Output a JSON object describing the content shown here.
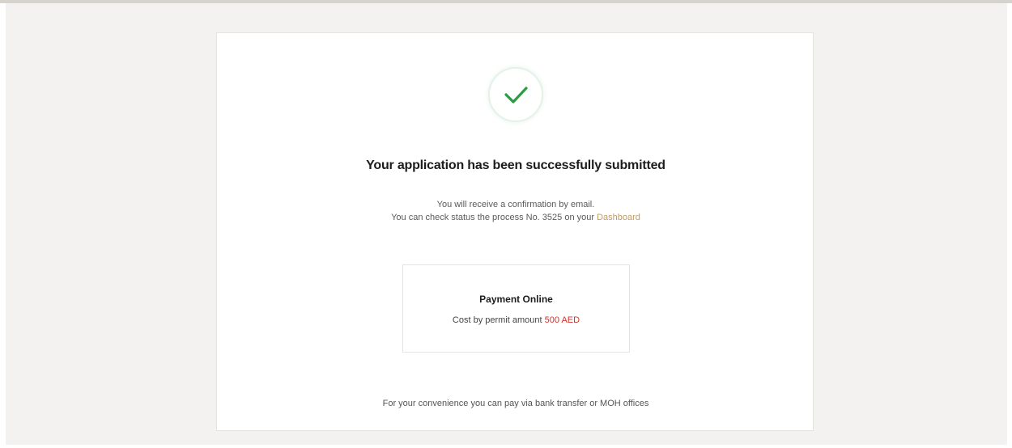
{
  "success": {
    "icon": "checkmark-icon",
    "title": "Your application has been successfully submitted",
    "message_line1": "You will receive a confirmation by email.",
    "message_line2_prefix": "You can check status the process No. 3525 on your",
    "dashboard_link": "Dashboard"
  },
  "payment": {
    "title": "Payment Online",
    "cost_label": "Cost by permit amount",
    "amount": "500 AED"
  },
  "footer": {
    "note": "For your convenience you can pay via bank transfer or MOH offices"
  },
  "colors": {
    "check": "#2e9a45",
    "link": "#c49a5f",
    "amount": "#d0312d",
    "background": "#f3f2f0"
  }
}
